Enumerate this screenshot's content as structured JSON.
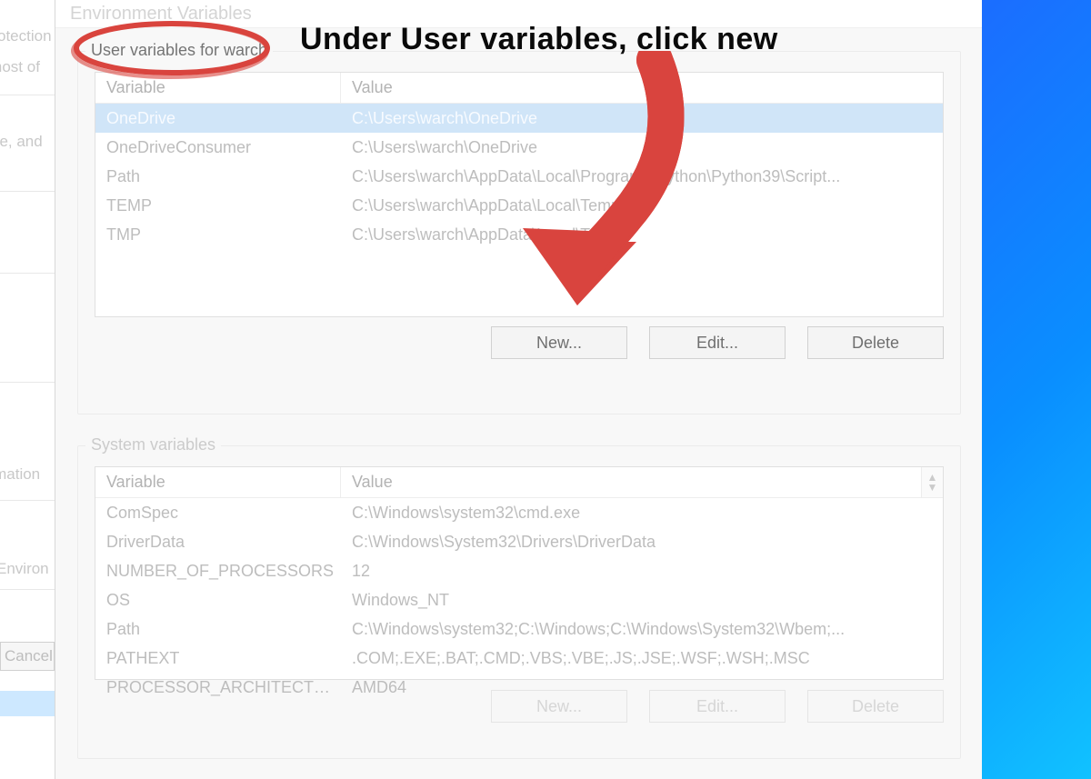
{
  "dialog_title": "Environment Variables",
  "annotation_text": "Under User variables, click new",
  "user_vars": {
    "legend": "User variables for warch",
    "headers": {
      "variable": "Variable",
      "value": "Value"
    },
    "rows": [
      {
        "variable": "OneDrive",
        "value": "C:\\Users\\warch\\OneDrive",
        "selected": true
      },
      {
        "variable": "OneDriveConsumer",
        "value": "C:\\Users\\warch\\OneDrive"
      },
      {
        "variable": "Path",
        "value": "C:\\Users\\warch\\AppData\\Local\\Programs\\Python\\Python39\\Script..."
      },
      {
        "variable": "TEMP",
        "value": "C:\\Users\\warch\\AppData\\Local\\Temp"
      },
      {
        "variable": "TMP",
        "value": "C:\\Users\\warch\\AppData\\Local\\Temp"
      }
    ],
    "buttons": {
      "new": "New...",
      "edit": "Edit...",
      "delete": "Delete"
    }
  },
  "system_vars": {
    "legend": "System variables",
    "headers": {
      "variable": "Variable",
      "value": "Value"
    },
    "rows": [
      {
        "variable": "ComSpec",
        "value": "C:\\Windows\\system32\\cmd.exe"
      },
      {
        "variable": "DriverData",
        "value": "C:\\Windows\\System32\\Drivers\\DriverData"
      },
      {
        "variable": "NUMBER_OF_PROCESSORS",
        "value": "12"
      },
      {
        "variable": "OS",
        "value": "Windows_NT"
      },
      {
        "variable": "Path",
        "value": "C:\\Windows\\system32;C:\\Windows;C:\\Windows\\System32\\Wbem;..."
      },
      {
        "variable": "PATHEXT",
        "value": ".COM;.EXE;.BAT;.CMD;.VBS;.VBE;.JS;.JSE;.WSF;.WSH;.MSC"
      },
      {
        "variable": "PROCESSOR_ARCHITECTURE",
        "value": "AMD64"
      }
    ],
    "buttons": {
      "new": "New...",
      "edit": "Edit...",
      "delete": "Delete"
    }
  },
  "bg_fragments": {
    "f1": "Protection",
    "f2": "e most of",
    "f3": "ge, and",
    "f4": "ormation",
    "f5": "Environ",
    "btn": "Cancel"
  }
}
